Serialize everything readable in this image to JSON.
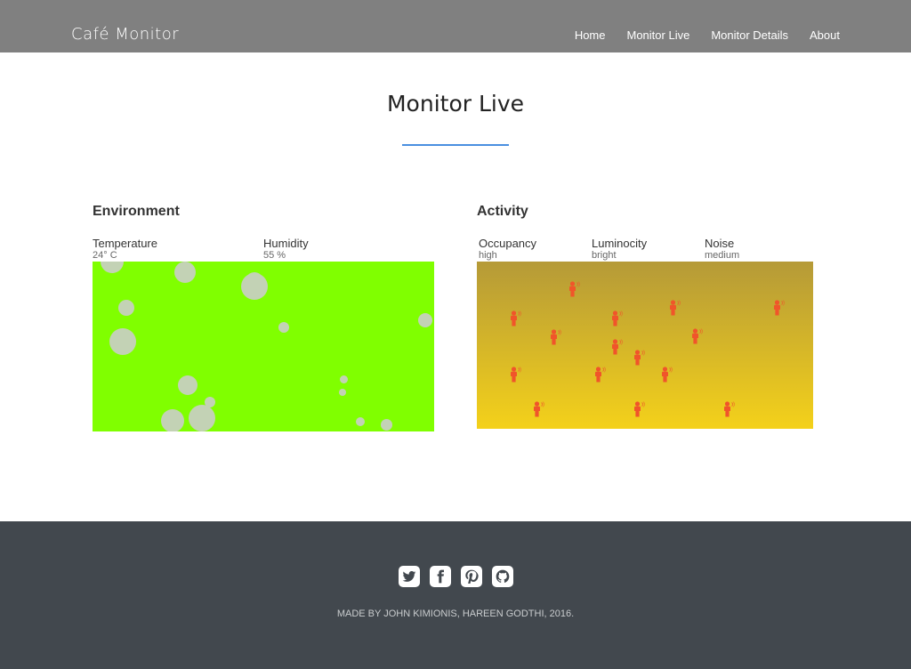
{
  "navbar": {
    "brand": "Café Monitor",
    "links": [
      {
        "label": "Home"
      },
      {
        "label": "Monitor Live"
      },
      {
        "label": "Monitor Details"
      },
      {
        "label": "About"
      }
    ]
  },
  "page": {
    "title": "Monitor Live"
  },
  "environment": {
    "title": "Environment",
    "temperature": {
      "label": "Temperature",
      "value": "24° C"
    },
    "humidity": {
      "label": "Humidity",
      "value": "55 %"
    },
    "background_color": "#80ff00",
    "bubble_color": "#c3d2b5"
  },
  "activity": {
    "title": "Activity",
    "occupancy": {
      "label": "Occupancy",
      "value": "high"
    },
    "luminocity": {
      "label": "Luminocity",
      "value": "bright"
    },
    "noise": {
      "label": "Noise",
      "value": "medium"
    },
    "gradient_top": "#b59a38",
    "gradient_bottom": "#f4d11a",
    "person_color": "#f0552a"
  },
  "footer": {
    "social_icons": [
      "twitter-icon",
      "facebook-icon",
      "pinterest-icon",
      "github-icon"
    ],
    "credit": "MADE BY JOHN KIMIONIS, HAREEN GODTHI, 2016."
  }
}
